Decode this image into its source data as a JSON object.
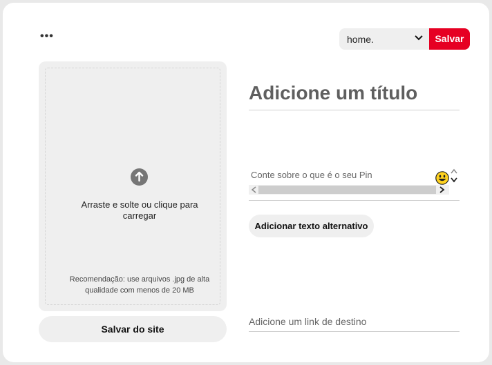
{
  "header": {
    "more_label": "•••",
    "board_select": {
      "value": "home."
    },
    "save_label": "Salvar"
  },
  "upload": {
    "instruction": "Arraste e solte ou clique para carregar",
    "recommendation": "Recomendação: use arquivos .jpg de alta qualidade com menos de 20 MB",
    "icon": "arrow-up-circle-icon"
  },
  "save_from_site_label": "Salvar do site",
  "form": {
    "title_placeholder": "Adicione um título",
    "description_placeholder": "Conte sobre o que é o seu Pin",
    "alt_text_button": "Adicionar texto alternativo",
    "link_placeholder": "Adicione um link de destino"
  },
  "colors": {
    "accent": "#e60023",
    "field_bg": "#efefef"
  }
}
